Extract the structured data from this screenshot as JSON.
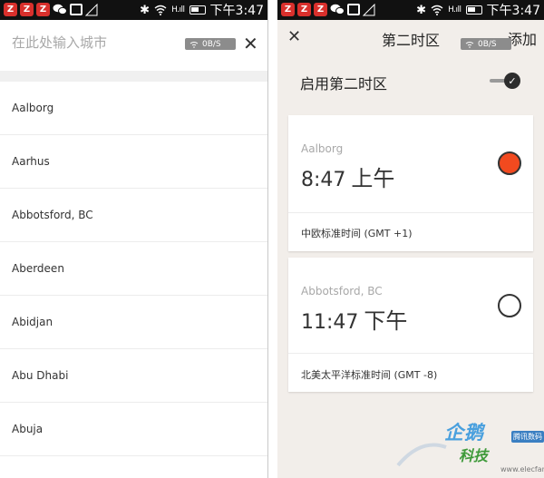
{
  "status_bar": {
    "notification_badge": "Z",
    "clock": "下午3:47",
    "signal_text": "H.ıll"
  },
  "left_screen": {
    "search": {
      "placeholder": "在此处输入城市"
    },
    "speed_badge": "0B/S",
    "cities": [
      "Aalborg",
      "Aarhus",
      "Abbotsford, BC",
      "Aberdeen",
      "Abidjan",
      "Abu Dhabi",
      "Abuja"
    ]
  },
  "right_screen": {
    "header": {
      "title": "第二时区",
      "add_label": "添加"
    },
    "speed_badge": "0B/S",
    "toggle": {
      "label": "启用第二时区",
      "on": true
    },
    "clocks": [
      {
        "city": "Aalborg",
        "time": "8:47",
        "ampm": "上午",
        "timezone": "中欧标准时间 (GMT +1)",
        "selected": true
      },
      {
        "city": "Abbotsford, BC",
        "time": "11:47",
        "ampm": "下午",
        "timezone": "北美太平洋标准时间 (GMT -8)",
        "selected": false
      }
    ],
    "accent_color": "#f24a1f"
  },
  "watermark": {
    "main": "企鹅",
    "sub": "科技",
    "tag": "腾讯数码",
    "url": "www.elecfans.com"
  }
}
